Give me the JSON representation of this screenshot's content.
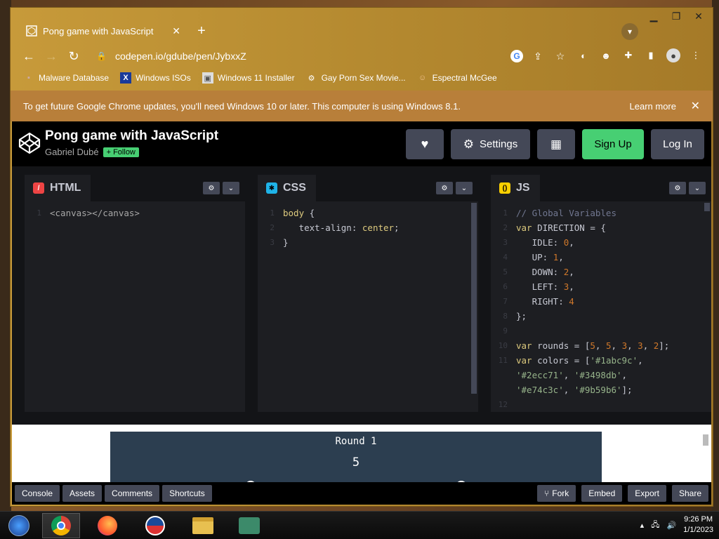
{
  "window": {
    "tab_title": "Pong game with JavaScript",
    "tab_close": "✕",
    "new_tab": "+",
    "minimize": "▭",
    "restore": "❐",
    "close": "✕"
  },
  "toolbar": {
    "url": "codepen.io/gdube/pen/JybxxZ"
  },
  "bookmarks": [
    {
      "label": "Malware Database",
      "icon": "folder-icon"
    },
    {
      "label": "Windows ISOs",
      "icon": "x-icon"
    },
    {
      "label": "Windows 11 Installer",
      "icon": "image-icon"
    },
    {
      "label": "Gay Porn Sex Movie...",
      "icon": "site-icon"
    },
    {
      "label": "Espectral McGee",
      "icon": "avatar-icon"
    }
  ],
  "infobar": {
    "message": "To get future Google Chrome updates, you'll need Windows 10 or later. This computer is using Windows 8.1.",
    "learn_more": "Learn more"
  },
  "codepen": {
    "title": "Pong game with JavaScript",
    "author": "Gabriel Dubé",
    "follow": "+ Follow",
    "settings": "Settings",
    "sign_up": "Sign Up",
    "log_in": "Log In"
  },
  "panes": {
    "html": {
      "label": "HTML"
    },
    "css": {
      "label": "CSS"
    },
    "js": {
      "label": "JS"
    }
  },
  "result": {
    "round": "Round 1",
    "score": "5"
  },
  "footer": {
    "console": "Console",
    "assets": "Assets",
    "comments": "Comments",
    "shortcuts": "Shortcuts",
    "fork": "Fork",
    "embed": "Embed",
    "export": "Export",
    "share": "Share"
  },
  "taskbar": {
    "time": "9:26 PM",
    "date": "1/1/2023"
  },
  "colors": {
    "codepen_green": "#47cf73",
    "canvas_bg": "#2c3e50",
    "infobar": "#b87f3a"
  }
}
